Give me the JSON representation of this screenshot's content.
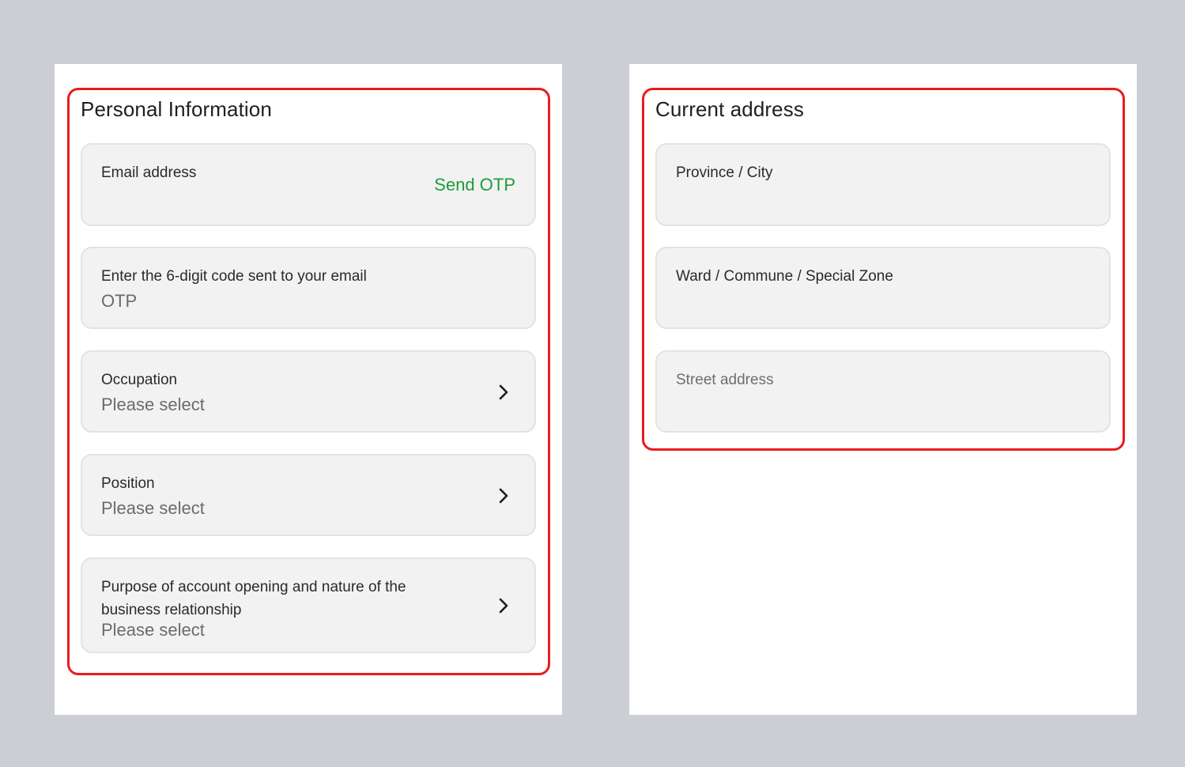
{
  "personal": {
    "title": "Personal Information",
    "email": {
      "label": "Email address",
      "action": "Send OTP"
    },
    "otp": {
      "label": "Enter the 6-digit code sent to your email",
      "placeholder": "OTP"
    },
    "occupation": {
      "label": "Occupation",
      "value": "Please select"
    },
    "position": {
      "label": "Position",
      "value": "Please select"
    },
    "purpose": {
      "label": "Purpose of account opening and nature of the business relationship",
      "value": "Please select"
    }
  },
  "address": {
    "title": "Current address",
    "province": {
      "label": "Province / City"
    },
    "ward": {
      "label": "Ward / Commune / Special Zone"
    },
    "street": {
      "placeholder": "Street address"
    }
  },
  "colors": {
    "highlight": "#ea1c1c",
    "action": "#1e9c3c",
    "background": "#cbced3"
  },
  "icons": {
    "chevron": "chevron-right-icon"
  }
}
